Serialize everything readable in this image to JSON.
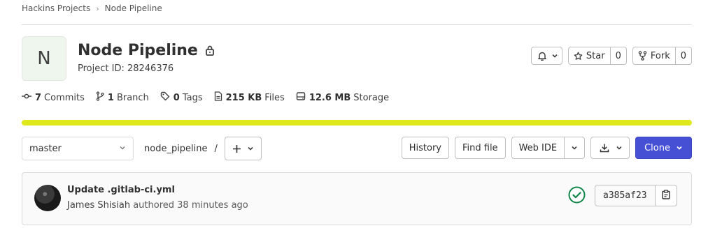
{
  "breadcrumb": {
    "group": "Hackins Projects",
    "separator": "›",
    "project": "Node Pipeline"
  },
  "project": {
    "initial": "N",
    "name": "Node Pipeline",
    "id_text": "Project ID: 28246376"
  },
  "header_actions": {
    "star_label": "Star",
    "star_count": "0",
    "fork_label": "Fork",
    "fork_count": "0"
  },
  "stats": {
    "commits_count": "7",
    "commits_label": "Commits",
    "branches_count": "1",
    "branches_label": "Branch",
    "tags_count": "0",
    "tags_label": "Tags",
    "files_size": "215 KB",
    "files_label": "Files",
    "storage_size": "12.6 MB",
    "storage_label": "Storage"
  },
  "storage_bar": {
    "color": "#dee81a"
  },
  "repo": {
    "branch": "master",
    "path": "node_pipeline",
    "path_sep": "/"
  },
  "toolbar": {
    "history": "History",
    "find_file": "Find file",
    "web_ide": "Web IDE",
    "clone": "Clone"
  },
  "last_commit": {
    "title": "Update .gitlab-ci.yml",
    "author": "James Shisiah",
    "action": "authored",
    "time": "38 minutes ago",
    "sha": "a385af23",
    "status_color": "#108548"
  },
  "colors": {
    "accent": "#4650d5",
    "success": "#108548"
  }
}
